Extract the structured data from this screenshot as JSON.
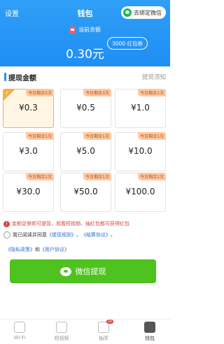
{
  "header": {
    "settings_label": "设置",
    "title": "钱包",
    "bind_button": "去绑定微信",
    "balance_label": "当前余额",
    "balance_value": "0.30元",
    "coupon_label": "3000 红包券"
  },
  "section": {
    "title": "提现金额",
    "notice_link": "提现须知"
  },
  "options": [
    {
      "amount": "¥0.3",
      "tag": "今日剩余5次",
      "selected": true
    },
    {
      "amount": "¥0.5",
      "tag": "今日剩余3次",
      "selected": false
    },
    {
      "amount": "¥1.0",
      "tag": "今日剩余1次",
      "selected": false
    },
    {
      "amount": "¥3.0",
      "tag": "今日剩余1次",
      "selected": false
    },
    {
      "amount": "¥5.0",
      "tag": "今日剩余1次",
      "selected": false
    },
    {
      "amount": "¥10.0",
      "tag": "今日剩余1次",
      "selected": false
    },
    {
      "amount": "¥30.0",
      "tag": "今日剩余1次",
      "selected": false
    },
    {
      "amount": "¥50.0",
      "tag": "今日剩余1次",
      "selected": false
    },
    {
      "amount": "¥100.0",
      "tag": "今日剩余1次",
      "selected": false
    }
  ],
  "notice": "金额足够即可提现，观看短视频、抽红包都可获得红包",
  "agreement": {
    "prefix": "我已阅读并同意",
    "rules": "《提现规则》",
    "sep1": "、",
    "settlement": "《结算协议》",
    "sep2": "、",
    "privacy": "《隐私政策》",
    "and": "和",
    "user": "《用户协议》"
  },
  "withdraw_button": "微信提现",
  "tabs": [
    {
      "label": "Wi-Fi",
      "icon": "wifi-icon",
      "active": false
    },
    {
      "label": "短视频",
      "icon": "video-icon",
      "active": false
    },
    {
      "label": "抽奖",
      "icon": "lottery-icon",
      "active": false,
      "badge": "10"
    },
    {
      "label": "钱包",
      "icon": "wallet-icon",
      "active": true
    }
  ]
}
